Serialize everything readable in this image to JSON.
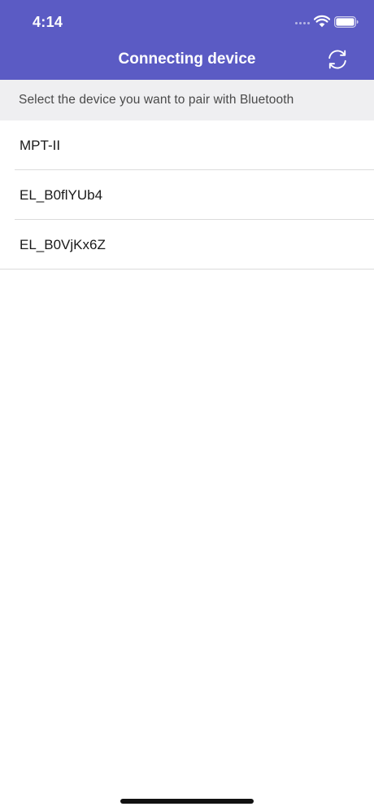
{
  "status_bar": {
    "time": "4:14",
    "icons": [
      "cellular-signal-icon",
      "wifi-icon",
      "battery-icon"
    ]
  },
  "nav_bar": {
    "title": "Connecting device",
    "right_icon": "refresh-icon"
  },
  "instruction": {
    "text": "Select the device you want to pair with Bluetooth"
  },
  "devices": [
    {
      "name": "MPT-II"
    },
    {
      "name": "EL_B0flYUb4"
    },
    {
      "name": "EL_B0VjKx6Z"
    }
  ],
  "colors": {
    "header_bg": "#5b5bc4",
    "instruction_bg": "#efeff1",
    "divider": "#dcdcdc",
    "text_primary": "#1a1a1a",
    "text_secondary": "#4a4a4a"
  }
}
